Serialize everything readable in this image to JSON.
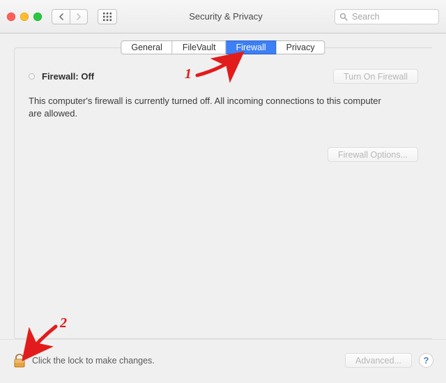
{
  "window": {
    "title": "Security & Privacy",
    "search_placeholder": "Search"
  },
  "tabs": {
    "general": "General",
    "filevault": "FileVault",
    "firewall": "Firewall",
    "privacy": "Privacy"
  },
  "firewall": {
    "status_label": "Firewall: Off",
    "turn_on_label": "Turn On Firewall",
    "description": "This computer's firewall is currently turned off. All incoming connections to this computer are allowed.",
    "options_label": "Firewall Options..."
  },
  "footer": {
    "lock_message": "Click the lock to make changes.",
    "advanced_label": "Advanced...",
    "help_label": "?"
  },
  "annotations": {
    "num1": "1",
    "num2": "2"
  }
}
